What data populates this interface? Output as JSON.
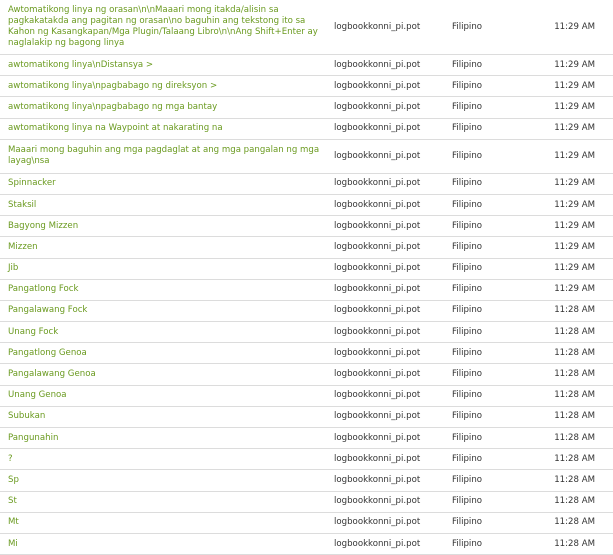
{
  "rows": [
    {
      "string": "Awtomatikong linya ng orasan\\n\\nMaaari mong itakda/alisin sa pagkakatakda ang pagitan ng orasan\\no baguhin ang tekstong ito sa Kahon ng Kasangkapan/Mga Plugin/Talaang Libro\\n\\nAng Shift+Enter ay naglalakip ng bagong linya",
      "file": "logbookkonni_pi.pot",
      "language": "Filipino",
      "time": "11:29 AM"
    },
    {
      "string": "awtomatikong linya\\nDistansya >",
      "file": "logbookkonni_pi.pot",
      "language": "Filipino",
      "time": "11:29 AM"
    },
    {
      "string": "awtomatikong linya\\npagbabago ng direksyon >",
      "file": "logbookkonni_pi.pot",
      "language": "Filipino",
      "time": "11:29 AM"
    },
    {
      "string": "awtomatikong linya\\npagbabago ng mga bantay",
      "file": "logbookkonni_pi.pot",
      "language": "Filipino",
      "time": "11:29 AM"
    },
    {
      "string": "awtomatikong linya na Waypoint at nakarating na",
      "file": "logbookkonni_pi.pot",
      "language": "Filipino",
      "time": "11:29 AM"
    },
    {
      "string": "Maaari mong baguhin ang mga pagdaglat at ang mga pangalan ng mga layag\\nsa",
      "file": "logbookkonni_pi.pot",
      "language": "Filipino",
      "time": "11:29 AM"
    },
    {
      "string": "Spinnacker",
      "file": "logbookkonni_pi.pot",
      "language": "Filipino",
      "time": "11:29 AM"
    },
    {
      "string": "Staksil",
      "file": "logbookkonni_pi.pot",
      "language": "Filipino",
      "time": "11:29 AM"
    },
    {
      "string": "Bagyong Mizzen",
      "file": "logbookkonni_pi.pot",
      "language": "Filipino",
      "time": "11:29 AM"
    },
    {
      "string": "Mizzen",
      "file": "logbookkonni_pi.pot",
      "language": "Filipino",
      "time": "11:29 AM"
    },
    {
      "string": "Jib",
      "file": "logbookkonni_pi.pot",
      "language": "Filipino",
      "time": "11:29 AM"
    },
    {
      "string": "Pangatlong Fock",
      "file": "logbookkonni_pi.pot",
      "language": "Filipino",
      "time": "11:29 AM"
    },
    {
      "string": "Pangalawang Fock",
      "file": "logbookkonni_pi.pot",
      "language": "Filipino",
      "time": "11:28 AM"
    },
    {
      "string": "Unang Fock",
      "file": "logbookkonni_pi.pot",
      "language": "Filipino",
      "time": "11:28 AM"
    },
    {
      "string": "Pangatlong Genoa",
      "file": "logbookkonni_pi.pot",
      "language": "Filipino",
      "time": "11:28 AM"
    },
    {
      "string": "Pangalawang Genoa",
      "file": "logbookkonni_pi.pot",
      "language": "Filipino",
      "time": "11:28 AM"
    },
    {
      "string": "Unang Genoa",
      "file": "logbookkonni_pi.pot",
      "language": "Filipino",
      "time": "11:28 AM"
    },
    {
      "string": "Subukan",
      "file": "logbookkonni_pi.pot",
      "language": "Filipino",
      "time": "11:28 AM"
    },
    {
      "string": "Pangunahin",
      "file": "logbookkonni_pi.pot",
      "language": "Filipino",
      "time": "11:28 AM"
    },
    {
      "string": "?",
      "file": "logbookkonni_pi.pot",
      "language": "Filipino",
      "time": "11:28 AM"
    },
    {
      "string": "Sp",
      "file": "logbookkonni_pi.pot",
      "language": "Filipino",
      "time": "11:28 AM"
    },
    {
      "string": "St",
      "file": "logbookkonni_pi.pot",
      "language": "Filipino",
      "time": "11:28 AM"
    },
    {
      "string": "Mt",
      "file": "logbookkonni_pi.pot",
      "language": "Filipino",
      "time": "11:28 AM"
    },
    {
      "string": "Mi",
      "file": "logbookkonni_pi.pot",
      "language": "Filipino",
      "time": "11:28 AM"
    }
  ],
  "colors": {
    "link": "#6a9a1f",
    "text": "#333333",
    "divider": "#dcdcdc"
  }
}
